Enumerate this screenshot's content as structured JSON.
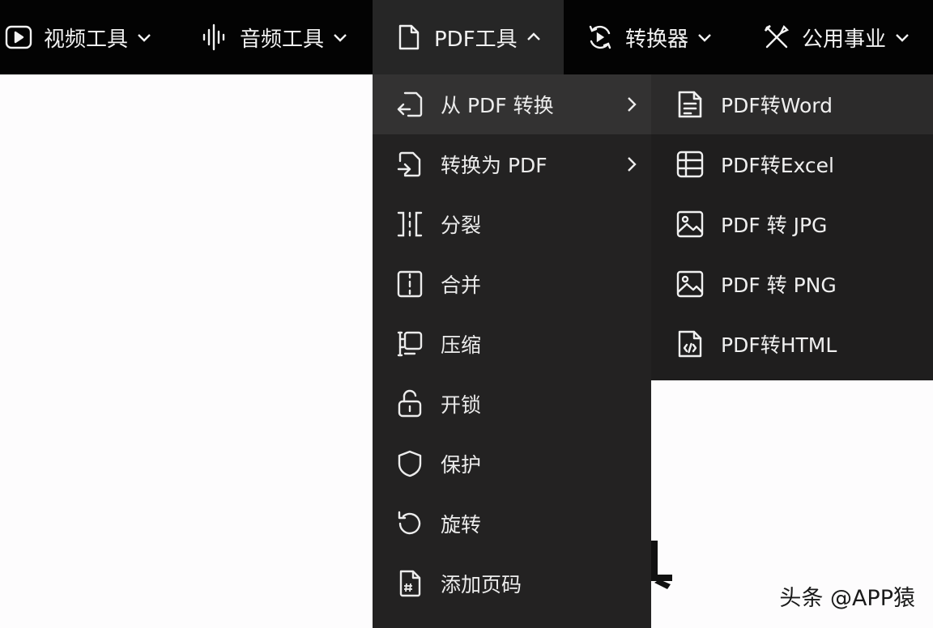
{
  "nav": {
    "items": [
      {
        "label": "视频工具",
        "icon": "play-circle-icon"
      },
      {
        "label": "音频工具",
        "icon": "audio-wave-icon"
      },
      {
        "label": "PDF工具",
        "icon": "document-icon",
        "active": true
      },
      {
        "label": "转换器",
        "icon": "convert-cycle-icon"
      },
      {
        "label": "公用事业",
        "icon": "tools-icon"
      }
    ]
  },
  "menu": {
    "items": [
      {
        "label": "从 PDF 转换",
        "icon": "export-from-pdf-icon",
        "has_submenu": true,
        "hover": true
      },
      {
        "label": "转换为 PDF",
        "icon": "import-to-pdf-icon",
        "has_submenu": true
      },
      {
        "label": "分裂",
        "icon": "split-icon"
      },
      {
        "label": "合并",
        "icon": "merge-icon"
      },
      {
        "label": "压缩",
        "icon": "compress-icon"
      },
      {
        "label": "开锁",
        "icon": "unlock-icon"
      },
      {
        "label": "保护",
        "icon": "shield-icon"
      },
      {
        "label": "旋转",
        "icon": "rotate-icon"
      },
      {
        "label": "添加页码",
        "icon": "page-number-icon"
      }
    ]
  },
  "submenu": {
    "items": [
      {
        "label": "PDF转Word",
        "icon": "word-doc-icon",
        "hover": true
      },
      {
        "label": "PDF转Excel",
        "icon": "table-icon"
      },
      {
        "label": "PDF 转 JPG",
        "icon": "image-icon"
      },
      {
        "label": "PDF 转 PNG",
        "icon": "image-icon"
      },
      {
        "label": "PDF转HTML",
        "icon": "html-file-icon"
      }
    ]
  },
  "watermark": "头条 @APP猿",
  "colors": {
    "navbar": "#030303",
    "nav_active": "#262626",
    "menu": "#232222",
    "menu_hover": "#333232",
    "submenu": "#1f1e1e",
    "text": "#f0f0f0",
    "page_bg": "#fdfcfd"
  }
}
